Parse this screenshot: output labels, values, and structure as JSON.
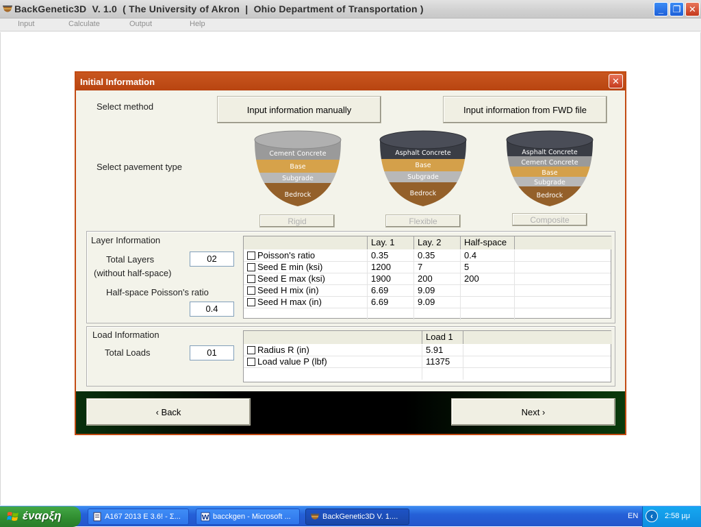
{
  "window": {
    "title": "BackGenetic3D  V. 1.0  ( The University of Akron  |  Ohio Department of Transportation )",
    "controls": {
      "minimize": "_",
      "restore": "❐",
      "close": "✕"
    }
  },
  "menu": [
    "Input",
    "Calculate",
    "Output",
    "Help"
  ],
  "dialog": {
    "title": "Initial Information",
    "close": "✕",
    "select_method_label": "Select method",
    "method_buttons": [
      "Input information manually",
      "Input information from FWD file"
    ],
    "select_pavement_label": "Select pavement type",
    "pavements": [
      {
        "button": "Rigid",
        "layers": [
          "Cement Concrete",
          "Base",
          "Subgrade",
          "Bedrock"
        ]
      },
      {
        "button": "Flexible",
        "layers": [
          "Asphalt Concrete",
          "Base",
          "Subgrade",
          "Bedrock"
        ]
      },
      {
        "button": "Composite",
        "layers": [
          "Asphalt Concrete",
          "Cement Concrete",
          "Base",
          "Subgrade",
          "Bedrock"
        ]
      }
    ],
    "layer_info": {
      "title": "Layer Information",
      "total_layers_label": "Total Layers",
      "total_layers_sub": "(without half-space)",
      "total_layers_value": "02",
      "poisson_label": "Half-space Poisson's ratio",
      "poisson_value": "0.4",
      "headers": [
        "",
        "Lay. 1",
        "Lay. 2",
        "Half-space",
        ""
      ],
      "rows": [
        {
          "name": "Poisson's ratio",
          "values": [
            "0.35",
            "0.35",
            "0.4"
          ]
        },
        {
          "name": "Seed E min (ksi)",
          "values": [
            "1200",
            "7",
            "5"
          ]
        },
        {
          "name": "Seed E max (ksi)",
          "values": [
            "1900",
            "200",
            "200"
          ]
        },
        {
          "name": "Seed H mix (in)",
          "values": [
            "6.69",
            "9.09",
            ""
          ]
        },
        {
          "name": "Seed H max (in)",
          "values": [
            "6.69",
            "9.09",
            ""
          ]
        }
      ]
    },
    "load_info": {
      "title": "Load Information",
      "total_loads_label": "Total Loads",
      "total_loads_value": "01",
      "headers": [
        "",
        "Load 1",
        ""
      ],
      "rows": [
        {
          "name": "Radius R (in)",
          "values": [
            "5.91"
          ]
        },
        {
          "name": "Load value P (lbf)",
          "values": [
            "11375"
          ]
        }
      ]
    },
    "back_label": "‹  Back",
    "next_label": "Next  ›"
  },
  "taskbar": {
    "start_label": "έναρξη",
    "tasks": [
      {
        "label": "A167 2013 E 3.6! - Σ...",
        "active": false
      },
      {
        "label": "bacckgen - Microsoft ...",
        "active": false
      },
      {
        "label": "BackGenetic3D  V. 1....",
        "active": true
      }
    ],
    "language": "EN",
    "clock": "2:58 μμ"
  }
}
